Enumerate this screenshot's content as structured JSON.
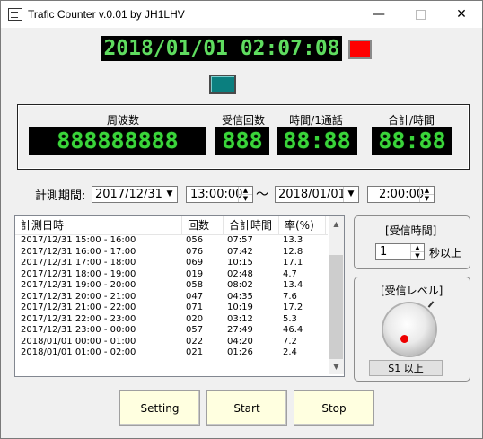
{
  "window": {
    "title": "Trafic Counter v.0.01 by JH1LHV",
    "controls": {
      "minimize": "—",
      "close": "✕"
    }
  },
  "clock": {
    "display": "2018/01/01 02:07:08"
  },
  "indicators": {
    "record_color": "#ff0000",
    "status_color": "#0b7f7f"
  },
  "meters": [
    {
      "label": "周波数",
      "value": "888888888"
    },
    {
      "label": "受信回数",
      "value": "888"
    },
    {
      "label": "時間/1通話",
      "value": "88:88"
    },
    {
      "label": "合計/時間",
      "value": "88:88"
    }
  ],
  "period": {
    "label": "計測期間:",
    "start_date": "2017/12/31",
    "start_time": "13:00:00",
    "separator": "～",
    "end_date": "2018/01/01",
    "end_time": "2:00:00"
  },
  "log_table": {
    "columns": [
      "計測日時",
      "回数",
      "合計時間",
      "率(%)"
    ],
    "rows": [
      [
        "2017/12/31 15:00 - 16:00",
        "056",
        "07:57",
        "13.3"
      ],
      [
        "2017/12/31 16:00 - 17:00",
        "076",
        "07:42",
        "12.8"
      ],
      [
        "2017/12/31 17:00 - 18:00",
        "069",
        "10:15",
        "17.1"
      ],
      [
        "2017/12/31 18:00 - 19:00",
        "019",
        "02:48",
        "4.7"
      ],
      [
        "2017/12/31 19:00 - 20:00",
        "058",
        "08:02",
        "13.4"
      ],
      [
        "2017/12/31 20:00 - 21:00",
        "047",
        "04:35",
        "7.6"
      ],
      [
        "2017/12/31 21:00 - 22:00",
        "071",
        "10:19",
        "17.2"
      ],
      [
        "2017/12/31 22:00 - 23:00",
        "020",
        "03:12",
        "5.3"
      ],
      [
        "2017/12/31 23:00 - 00:00",
        "057",
        "27:49",
        "46.4"
      ],
      [
        "2018/01/01 00:00 - 01:00",
        "022",
        "04:20",
        "7.2"
      ],
      [
        "2018/01/01 01:00 - 02:00",
        "021",
        "01:26",
        "2.4"
      ]
    ]
  },
  "recv_time": {
    "title": "[受信時間]",
    "value": "1",
    "unit": "秒以上"
  },
  "recv_level": {
    "title": "[受信レベル]",
    "value": "S1 以上"
  },
  "buttons": {
    "setting": "Setting",
    "start": "Start",
    "stop": "Stop"
  }
}
